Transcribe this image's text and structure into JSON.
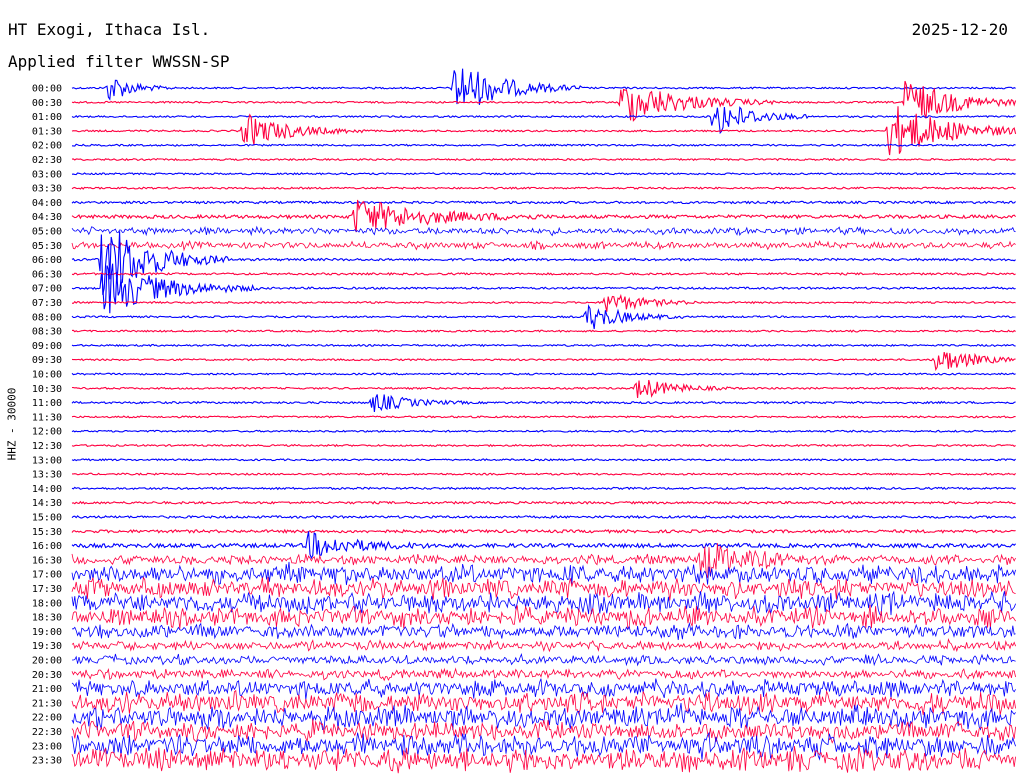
{
  "header": {
    "station": "HT Exogi, Ithaca Isl.",
    "filter": "Applied filter  WWSSN-SP",
    "date": "2025-12-20"
  },
  "channel_label": "HHZ - 30000",
  "colors": {
    "blue": "#0000ff",
    "red": "#ff0040",
    "text": "#000000",
    "background": "#ffffff"
  },
  "chart_data": {
    "type": "line",
    "title": "HT Exogi, Ithaca Isl.",
    "subtitle": "Applied filter  WWSSN-SP",
    "ylabel": "HHZ - 30000",
    "xlabel": "",
    "grid": false,
    "legend": "none",
    "rows": [
      "00:00",
      "00:30",
      "01:00",
      "01:30",
      "02:00",
      "02:30",
      "03:00",
      "03:30",
      "04:00",
      "04:30",
      "05:00",
      "05:30",
      "06:00",
      "06:30",
      "07:00",
      "07:30",
      "08:00",
      "08:30",
      "09:00",
      "09:30",
      "10:00",
      "10:30",
      "11:00",
      "11:30",
      "12:00",
      "12:30",
      "13:00",
      "13:30",
      "14:00",
      "14:30",
      "15:00",
      "15:30",
      "16:00",
      "16:30",
      "17:00",
      "17:30",
      "18:00",
      "18:30",
      "19:00",
      "19:30",
      "20:00",
      "20:30",
      "21:00",
      "21:30",
      "22:00",
      "22:30",
      "23:00",
      "23:30"
    ],
    "row_minutes": 30,
    "row_colors": [
      "blue",
      "red"
    ],
    "noise_level": [
      0.06,
      0.06,
      0.06,
      0.06,
      0.06,
      0.06,
      0.06,
      0.06,
      0.08,
      0.12,
      0.22,
      0.22,
      0.08,
      0.07,
      0.07,
      0.06,
      0.06,
      0.06,
      0.06,
      0.06,
      0.06,
      0.06,
      0.07,
      0.06,
      0.06,
      0.06,
      0.06,
      0.06,
      0.07,
      0.08,
      0.08,
      0.1,
      0.14,
      0.3,
      0.6,
      0.6,
      0.65,
      0.6,
      0.45,
      0.3,
      0.3,
      0.3,
      0.55,
      0.65,
      0.7,
      0.6,
      0.7,
      0.75
    ],
    "events": [
      {
        "row": 0,
        "minute": 1.2,
        "amplitude": 1.0,
        "duration": 2.0
      },
      {
        "row": 0,
        "minute": 12.2,
        "amplitude": 2.0,
        "duration": 4.0
      },
      {
        "row": 1,
        "minute": 17.5,
        "amplitude": 1.6,
        "duration": 5.0
      },
      {
        "row": 1,
        "minute": 26.5,
        "amplitude": 1.8,
        "duration": 4.0
      },
      {
        "row": 2,
        "minute": 20.4,
        "amplitude": 1.5,
        "duration": 3.0
      },
      {
        "row": 3,
        "minute": 5.5,
        "amplitude": 1.2,
        "duration": 4.0
      },
      {
        "row": 3,
        "minute": 26.0,
        "amplitude": 2.0,
        "duration": 5.0
      },
      {
        "row": 9,
        "minute": 9.0,
        "amplitude": 1.3,
        "duration": 6.0
      },
      {
        "row": 12,
        "minute": 1.0,
        "amplitude": 3.0,
        "duration": 4.0
      },
      {
        "row": 14,
        "minute": 1.0,
        "amplitude": 2.0,
        "duration": 5.0
      },
      {
        "row": 15,
        "minute": 17.0,
        "amplitude": 0.8,
        "duration": 3.0
      },
      {
        "row": 16,
        "minute": 16.4,
        "amplitude": 1.0,
        "duration": 3.0
      },
      {
        "row": 19,
        "minute": 27.5,
        "amplitude": 1.0,
        "duration": 3.0
      },
      {
        "row": 21,
        "minute": 18.0,
        "amplitude": 0.8,
        "duration": 3.0
      },
      {
        "row": 22,
        "minute": 9.6,
        "amplitude": 0.7,
        "duration": 3.0
      },
      {
        "row": 32,
        "minute": 7.5,
        "amplitude": 0.9,
        "duration": 4.0
      },
      {
        "row": 33,
        "minute": 20.0,
        "amplitude": 1.2,
        "duration": 4.0
      }
    ]
  }
}
